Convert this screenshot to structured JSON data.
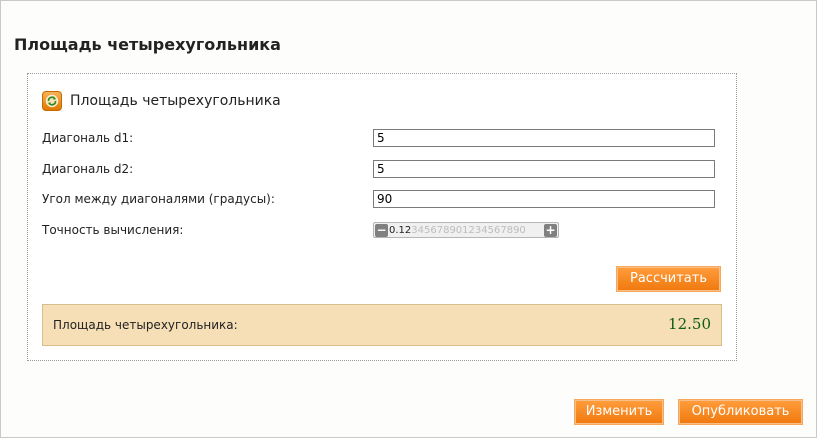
{
  "page": {
    "title": "Площадь четырехугольника"
  },
  "panel": {
    "title": "Площадь четырехугольника",
    "icon": "refresh-icon"
  },
  "fields": [
    {
      "label": "Диагональ d1:",
      "value": "5"
    },
    {
      "label": "Диагональ d2:",
      "value": "5"
    },
    {
      "label": "Угол между диагоналями (градусы):",
      "value": "90"
    }
  ],
  "precision": {
    "label": "Точность вычисления:",
    "value": "0.12",
    "remaining_digits": "345678901234567890",
    "minus": "−",
    "plus": "+"
  },
  "actions": {
    "calculate": "Рассчитать",
    "edit": "Изменить",
    "publish": "Опубликовать"
  },
  "result": {
    "label": "Площадь четырехугольника:",
    "value": "12.50"
  },
  "colors": {
    "accent": "#f07a10",
    "result_bg": "#f6dfb6",
    "result_text": "#0d5e0d"
  }
}
